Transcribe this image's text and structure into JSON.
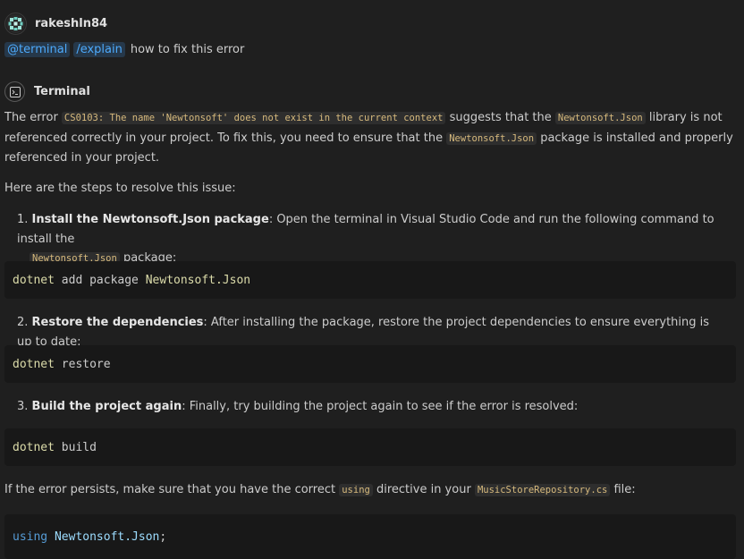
{
  "user": {
    "name": "rakeshln84"
  },
  "query": {
    "agent": "@terminal",
    "command": "/explain",
    "text": "how to fix this error"
  },
  "response": {
    "agent_label": "Terminal",
    "intro": {
      "t1": "The error ",
      "code1": "CS0103: The name 'Newtonsoft' does not exist in the current context",
      "t2": " suggests that the ",
      "code2": "Newtonsoft.Json",
      "t3": " library is not referenced correctly in your project. To fix this, you need to ensure that the ",
      "code3": "Newtonsoft.Json",
      "t4": " package is installed and properly referenced in your project."
    },
    "steps_intro": "Here are the steps to resolve this issue:",
    "steps": [
      {
        "num": "1.",
        "title": "Install the Newtonsoft.Json package",
        "t1": ": Open the terminal in Visual Studio Code and run the following command to install the ",
        "code": "Newtonsoft.Json",
        "t2": " package:",
        "command": {
          "tool": "dotnet",
          "rest1": " add package ",
          "pkg": "Newtonsoft.Json"
        }
      },
      {
        "num": "2.",
        "title": "Restore the dependencies",
        "t1": ": After installing the package, restore the project dependencies to ensure everything is up to date:",
        "command": {
          "tool": "dotnet",
          "rest1": " restore"
        }
      },
      {
        "num": "3.",
        "title": "Build the project again",
        "t1": ": Finally, try building the project again to see if the error is resolved:",
        "command": {
          "tool": "dotnet",
          "rest1": " build"
        }
      }
    ],
    "outro": {
      "t1": "If the error persists, make sure that you have the correct ",
      "code1": "using",
      "t2": " directive in your ",
      "code2": "MusicStoreRepository.cs",
      "t3": " file:"
    },
    "using_block": {
      "keyword": "using",
      "namespace": "Newtonsoft.Json",
      "semi": ";"
    }
  }
}
